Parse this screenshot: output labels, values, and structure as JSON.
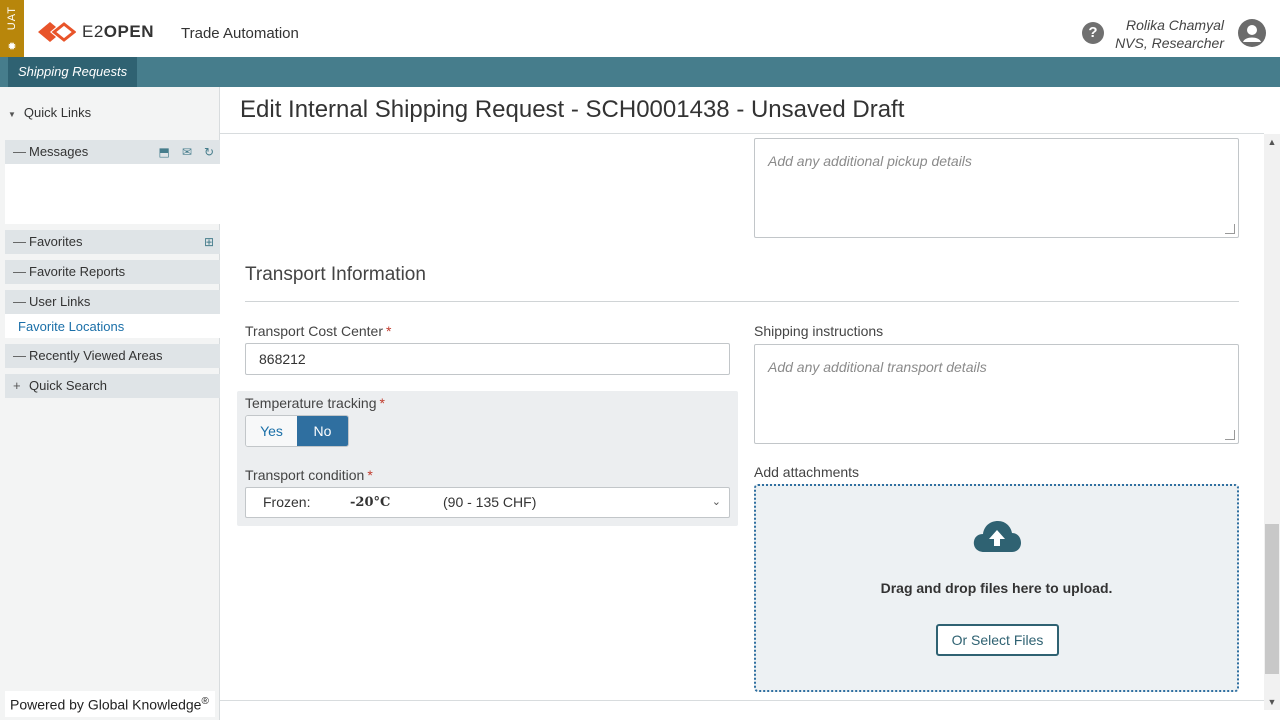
{
  "env": {
    "label": "UAT"
  },
  "brand": {
    "logo_text_a": "E2",
    "logo_text_b": "OPEN"
  },
  "header": {
    "app_title": "Trade Automation",
    "user_name": "Rolika Chamyal",
    "user_role": "NVS, Researcher"
  },
  "nav": {
    "active_tab": "Shipping Requests"
  },
  "sidebar": {
    "quick_links": "Quick Links",
    "messages": "Messages",
    "favorites": "Favorites",
    "favorite_reports": "Favorite Reports",
    "user_links": "User Links",
    "favorite_locations": "Favorite Locations",
    "recently_viewed": "Recently Viewed Areas",
    "quick_search": "Quick Search",
    "powered_by": "Powered by Global Knowledge",
    "powered_mark": "®"
  },
  "page": {
    "title": "Edit Internal Shipping Request - SCH0001438 - Unsaved Draft"
  },
  "form": {
    "pickup_placeholder": "Add any additional pickup details",
    "section_title": "Transport Information",
    "cost_center_label": "Transport Cost Center",
    "cost_center_value": "868212",
    "shipping_instructions_label": "Shipping instructions",
    "shipping_placeholder": "Add any additional transport details",
    "temp_tracking_label": "Temperature tracking",
    "temp_yes": "Yes",
    "temp_no": "No",
    "temp_selected": "No",
    "transport_condition_label": "Transport condition",
    "condition_name": "Frozen:",
    "condition_temp": "-20°C",
    "condition_price": "(90 - 135 CHF)",
    "required_mark": "*",
    "attachments_label": "Add attachments",
    "drop_text": "Drag and drop files here to upload.",
    "select_files": "Or Select Files"
  },
  "colors": {
    "nav_bar": "#467d8c",
    "env_strip": "#b8860b",
    "accent_blue": "#2f6fa0",
    "logo_orange": "#e8542a"
  }
}
